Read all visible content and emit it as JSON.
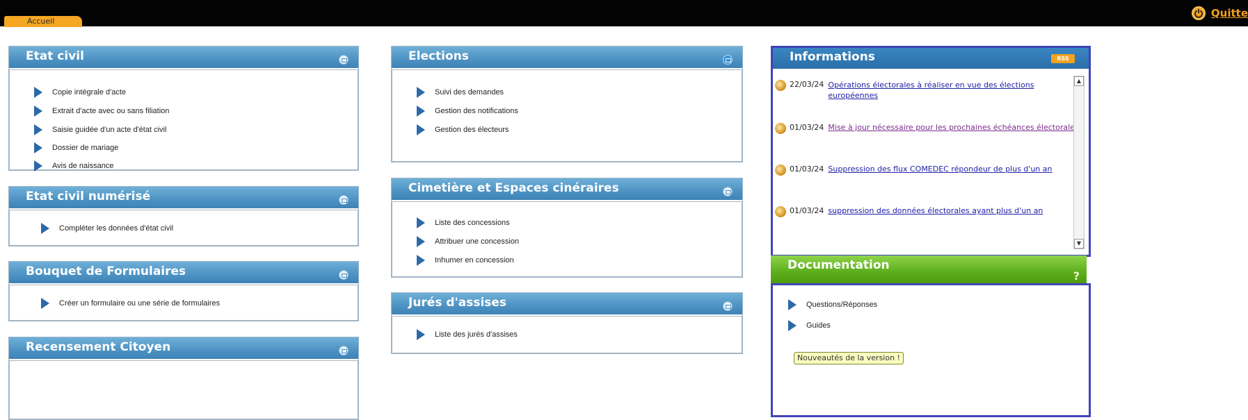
{
  "topbar": {
    "home_tab": "Accueil",
    "quit_label": "Quitte"
  },
  "panels": {
    "etat_civil": {
      "title": "Etat civil",
      "items": [
        "Copie intégrale d'acte",
        "Extrait d'acte avec ou sans filiation",
        "Saisie guidée d'un acte d'état civil",
        "Dossier de mariage",
        "Avis de naissance"
      ]
    },
    "etat_civil_numerise": {
      "title": "Etat civil numérisé",
      "items": [
        "Compléter les données d'état civil"
      ]
    },
    "bouquet": {
      "title": "Bouquet de Formulaires",
      "items": [
        "Créer un formulaire ou une série de formulaires"
      ]
    },
    "recensement": {
      "title": "Recensement Citoyen"
    },
    "elections": {
      "title": "Elections",
      "items": [
        "Suivi des demandes",
        "Gestion des notifications",
        "Gestion des électeurs"
      ]
    },
    "cimetiere": {
      "title": "Cimetière et Espaces cinéraires",
      "items": [
        "Liste des concessions",
        "Attribuer une concession",
        "Inhumer en concession"
      ]
    },
    "jures": {
      "title": "Jurés d'assises",
      "items": [
        "Liste des jurés d'assises"
      ]
    }
  },
  "informations": {
    "title": "Informations",
    "rss": "RSS",
    "news": [
      {
        "date": "22/03/24",
        "text": "Opérations électorales à réaliser en vue des élections européennes"
      },
      {
        "date": "01/03/24",
        "text": "Mise à jour nécessaire pour les prochaines échéances électorales"
      },
      {
        "date": "01/03/24",
        "text": "Suppression des flux COMEDEC répondeur de plus d'un an"
      },
      {
        "date": "01/03/24",
        "text": "suppression des données électorales ayant plus d'un an"
      }
    ]
  },
  "documentation": {
    "title": "Documentation",
    "help": "?",
    "items": [
      "Questions/Réponses",
      "Guides"
    ],
    "new_version_button": "Nouveautés de la version !"
  },
  "colors": {
    "panel_header": "#4d92c3",
    "doc_header": "#5fb11e",
    "accent_orange": "#f5a623",
    "highlight_border": "#4044b8"
  }
}
